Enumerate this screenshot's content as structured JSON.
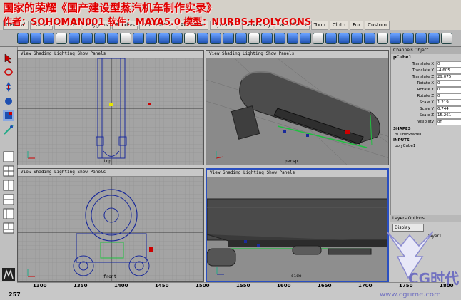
{
  "overlay": {
    "title_line1": "国家的荣耀《国产建设型蒸汽机车制作实录》",
    "title_line2": "作者：SOHOMAN001  软件：MAYA5.0  模型：NURBS+POLYGONS"
  },
  "app": {
    "menu_items": [
      "General",
      "Curves",
      "Surfaces",
      "Polygons",
      "Subdivs",
      "Deformation",
      "Animation",
      "Dynamics",
      "Rendering",
      "PaintEffects",
      "Toon",
      "Cloth",
      "Fur",
      "Custom"
    ]
  },
  "viewports": {
    "menu_text": "View Shading Lighting Show Panels",
    "top_label": "top",
    "persp_label": "persp",
    "front_label": "front",
    "side_label": "side"
  },
  "channel_box": {
    "header": "Channels Object",
    "object_name": "pCube1",
    "attributes": [
      {
        "name": "Translate X",
        "value": "0"
      },
      {
        "name": "Translate Y",
        "value": "-4.605"
      },
      {
        "name": "Translate Z",
        "value": "29.075"
      },
      {
        "name": "Rotate X",
        "value": "0"
      },
      {
        "name": "Rotate Y",
        "value": "0"
      },
      {
        "name": "Rotate Z",
        "value": "0"
      },
      {
        "name": "Scale X",
        "value": "1.219"
      },
      {
        "name": "Scale Y",
        "value": "6.744"
      },
      {
        "name": "Scale Z",
        "value": "15.261"
      },
      {
        "name": "Visibility",
        "value": "on"
      }
    ],
    "shapes_label": "SHAPES",
    "shape_name": "pCubeShape1",
    "inputs_label": "INPUTS",
    "input_name": "polyCube1"
  },
  "layers": {
    "header": "Layers Options",
    "mode": "Display",
    "layer_name": "layer1"
  },
  "timeline": {
    "current_frame": "257",
    "ticks": [
      "1300",
      "1350",
      "1400",
      "1450",
      "1500",
      "1550",
      "1600",
      "1650",
      "1700",
      "1750",
      "1800"
    ]
  },
  "watermark": {
    "text": "CG时代",
    "url": "www.cgtime.com"
  },
  "colors": {
    "title_red": "#e00000",
    "active_border": "#2a4fc0",
    "wire_blue": "#1a2a9a"
  }
}
